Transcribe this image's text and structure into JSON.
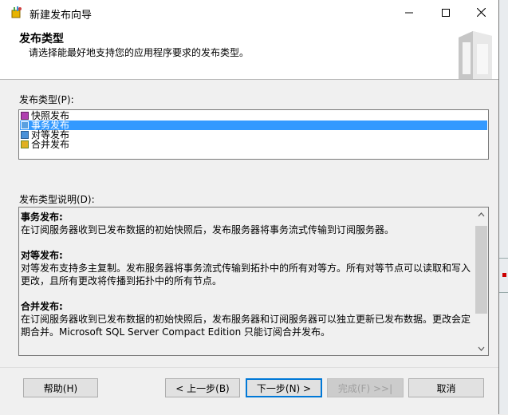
{
  "window": {
    "title": "新建发布向导"
  },
  "header": {
    "title": "发布类型",
    "subtitle": "请选择能最好地支持您的应用程序要求的发布类型。"
  },
  "types": {
    "label": "发布类型(P):",
    "items": [
      {
        "label": "快照发布",
        "selected": false,
        "icon": "snapshot-publication-icon"
      },
      {
        "label": "事务发布",
        "selected": true,
        "icon": "transactional-publication-icon"
      },
      {
        "label": "对等发布",
        "selected": false,
        "icon": "peer-to-peer-publication-icon"
      },
      {
        "label": "合并发布",
        "selected": false,
        "icon": "merge-publication-icon"
      }
    ]
  },
  "description": {
    "label": "发布类型说明(D):",
    "sections": [
      {
        "title": "事务发布:",
        "text": "在订阅服务器收到已发布数据的初始快照后，发布服务器将事务流式传输到订阅服务器。"
      },
      {
        "title": "对等发布:",
        "text": "对等发布支持多主复制。发布服务器将事务流式传输到拓扑中的所有对等方。所有对等节点可以读取和写入更改，且所有更改将传播到拓扑中的所有节点。"
      },
      {
        "title": "合并发布:",
        "text": "在订阅服务器收到已发布数据的初始快照后，发布服务器和订阅服务器可以独立更新已发布数据。更改会定期合并。Microsoft SQL Server Compact Edition 只能订阅合并发布。"
      }
    ]
  },
  "buttons": {
    "help": "帮助(H)",
    "back": "< 上一步(B)",
    "next": "下一步(N) >",
    "finish": "完成(F) >>|",
    "cancel": "取消"
  },
  "colors": {
    "selection": "#3399ff",
    "default_button_border": "#0078d7"
  }
}
